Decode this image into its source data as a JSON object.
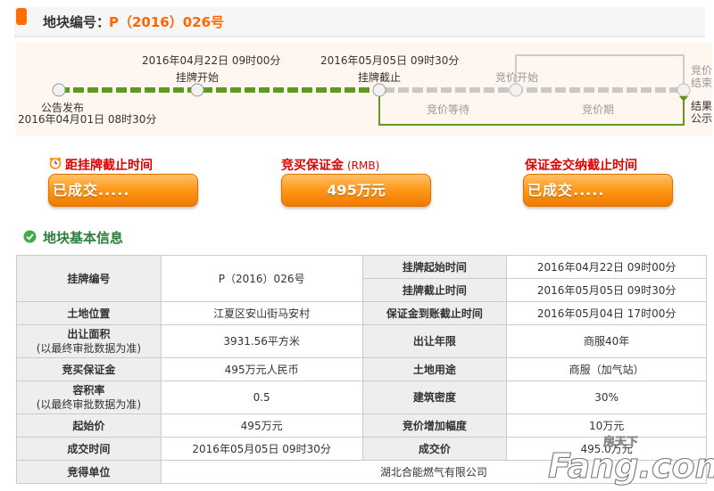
{
  "header": {
    "label": "地块编号：",
    "code": "P（2016）026号"
  },
  "timeline": {
    "publish_label": "公告发布",
    "publish_time": "2016年04月01日  08时30分",
    "listing_start_time": "2016年04月22日  09时00分",
    "listing_start_label": "挂牌开始",
    "listing_end_time": "2016年05月05日  09时30分",
    "listing_end_label": "挂牌截止",
    "bidding_start_label": "竞价开始",
    "bidding_wait_label": "竞价等待",
    "bidding_period_label": "竞价期",
    "bidding_end_label_1": "竞价",
    "bidding_end_label_2": "结束",
    "result_label_1": "结果",
    "result_label_2": "公示"
  },
  "status": {
    "deadline_title": "距挂牌截止时间",
    "deadline_value": "已成交.....",
    "deposit_title": "竞买保证金",
    "deposit_unit": "(RMB)",
    "deposit_value": "495万元",
    "deposit_deadline_title": "保证金交纳截止时间",
    "deposit_deadline_value": "已成交....."
  },
  "section": {
    "title": "地块基本信息"
  },
  "table": {
    "listing_no_label": "挂牌编号",
    "listing_no": "P（2016）026号",
    "listing_start_label": "挂牌起始时间",
    "listing_start": "2016年04月22日  09时00分",
    "listing_end_label": "挂牌截止时间",
    "listing_end": "2016年05月05日  09时30分",
    "location_label": "土地位置",
    "location": "江夏区安山街马安村",
    "deposit_due_label": "保证金到账截止时间",
    "deposit_due": "2016年05月04日  17时00分",
    "area_label": "出让面积",
    "area_sub": "(以最终审批数据为准)",
    "area": "3931.56平方米",
    "term_label": "出让年限",
    "term": "商服40年",
    "bid_deposit_label": "竞买保证金",
    "bid_deposit": "495万元人民币",
    "usage_label": "土地用途",
    "usage": "商服（加气站）",
    "plot_ratio_label": "容积率",
    "plot_ratio_sub": "(以最终审批数据为准)",
    "plot_ratio": "0.5",
    "density_label": "建筑密度",
    "density": "30%",
    "start_price_label": "起始价",
    "start_price": "495万元",
    "increment_label": "竞价增加幅度",
    "increment": "10万元",
    "deal_time_label": "成交时间",
    "deal_time": "2016年05月05日  09时30分",
    "deal_price_label": "成交价",
    "deal_price": "495.0万元",
    "winner_label": "竞得单位",
    "winner": "湖北合能燃气有限公司"
  },
  "watermark": {
    "top": "房天下",
    "main": "Fang.com"
  },
  "colors": {
    "accent_orange": "#ff6600",
    "timeline_green": "#5f9a1e",
    "status_red": "#e00000",
    "section_green": "#2a7d3a"
  }
}
